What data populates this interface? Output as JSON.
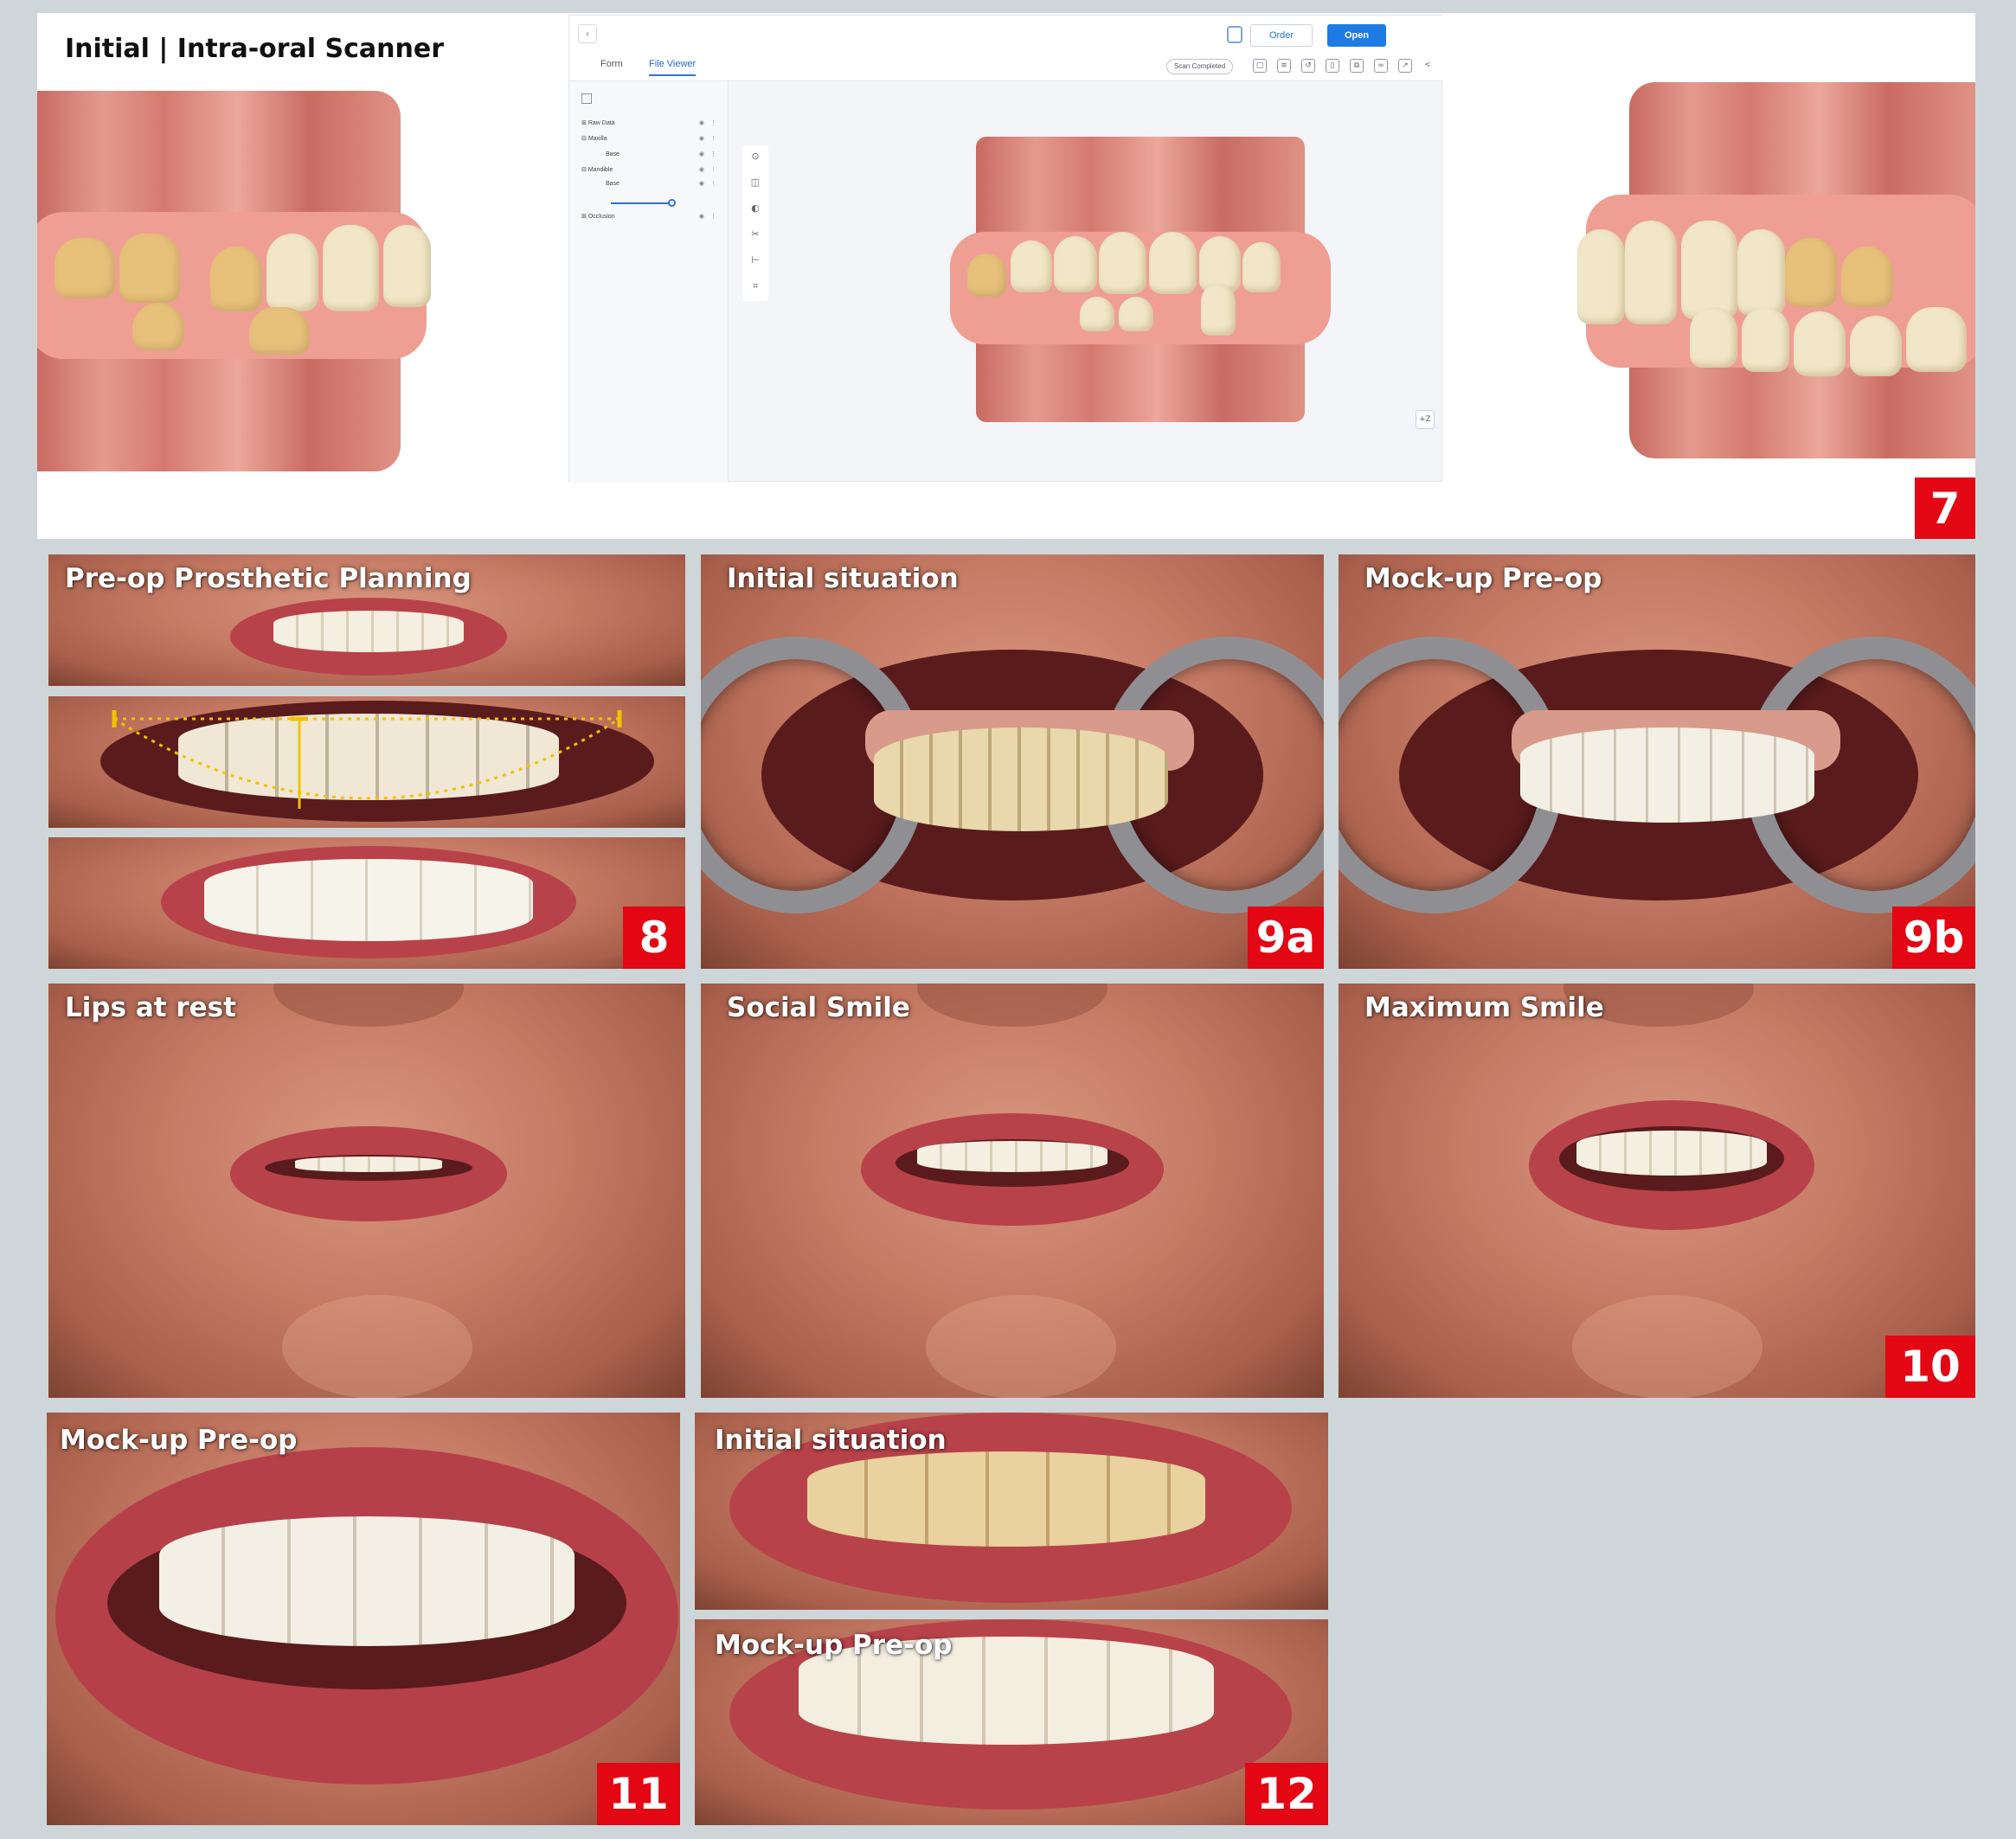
{
  "panels": {
    "fig7": {
      "caption": "Initial | Intra-oral Scanner",
      "number": "7",
      "viewer": {
        "back_icon": "‹",
        "order_label": "Order",
        "open_label": "Open",
        "tabs": [
          "Form",
          "File Viewer"
        ],
        "status": "Scan Completed",
        "tree": [
          "Raw Data",
          "Maxilla",
          "Base",
          "Mandible",
          "Base",
          "Occlusion"
        ],
        "zoom_label": "+Z"
      }
    },
    "fig8": {
      "caption": "Pre-op Prosthetic Planning",
      "number": "8"
    },
    "fig9a": {
      "caption": "Initial situation",
      "number": "9a"
    },
    "fig9b": {
      "caption": "Mock-up Pre-op",
      "number": "9b"
    },
    "fig10a": {
      "caption": "Lips at rest"
    },
    "fig10b": {
      "caption": "Social Smile"
    },
    "fig10c": {
      "caption": "Maximum Smile",
      "number": "10"
    },
    "fig11": {
      "caption": "Mock-up Pre-op",
      "number": "11"
    },
    "fig12a": {
      "caption": "Initial situation"
    },
    "fig12b": {
      "caption": "Mock-up Pre-op",
      "number": "12"
    }
  },
  "colors": {
    "badge": "#e30613",
    "background": "#cfd6da",
    "viewer_accent": "#1f7be4"
  }
}
